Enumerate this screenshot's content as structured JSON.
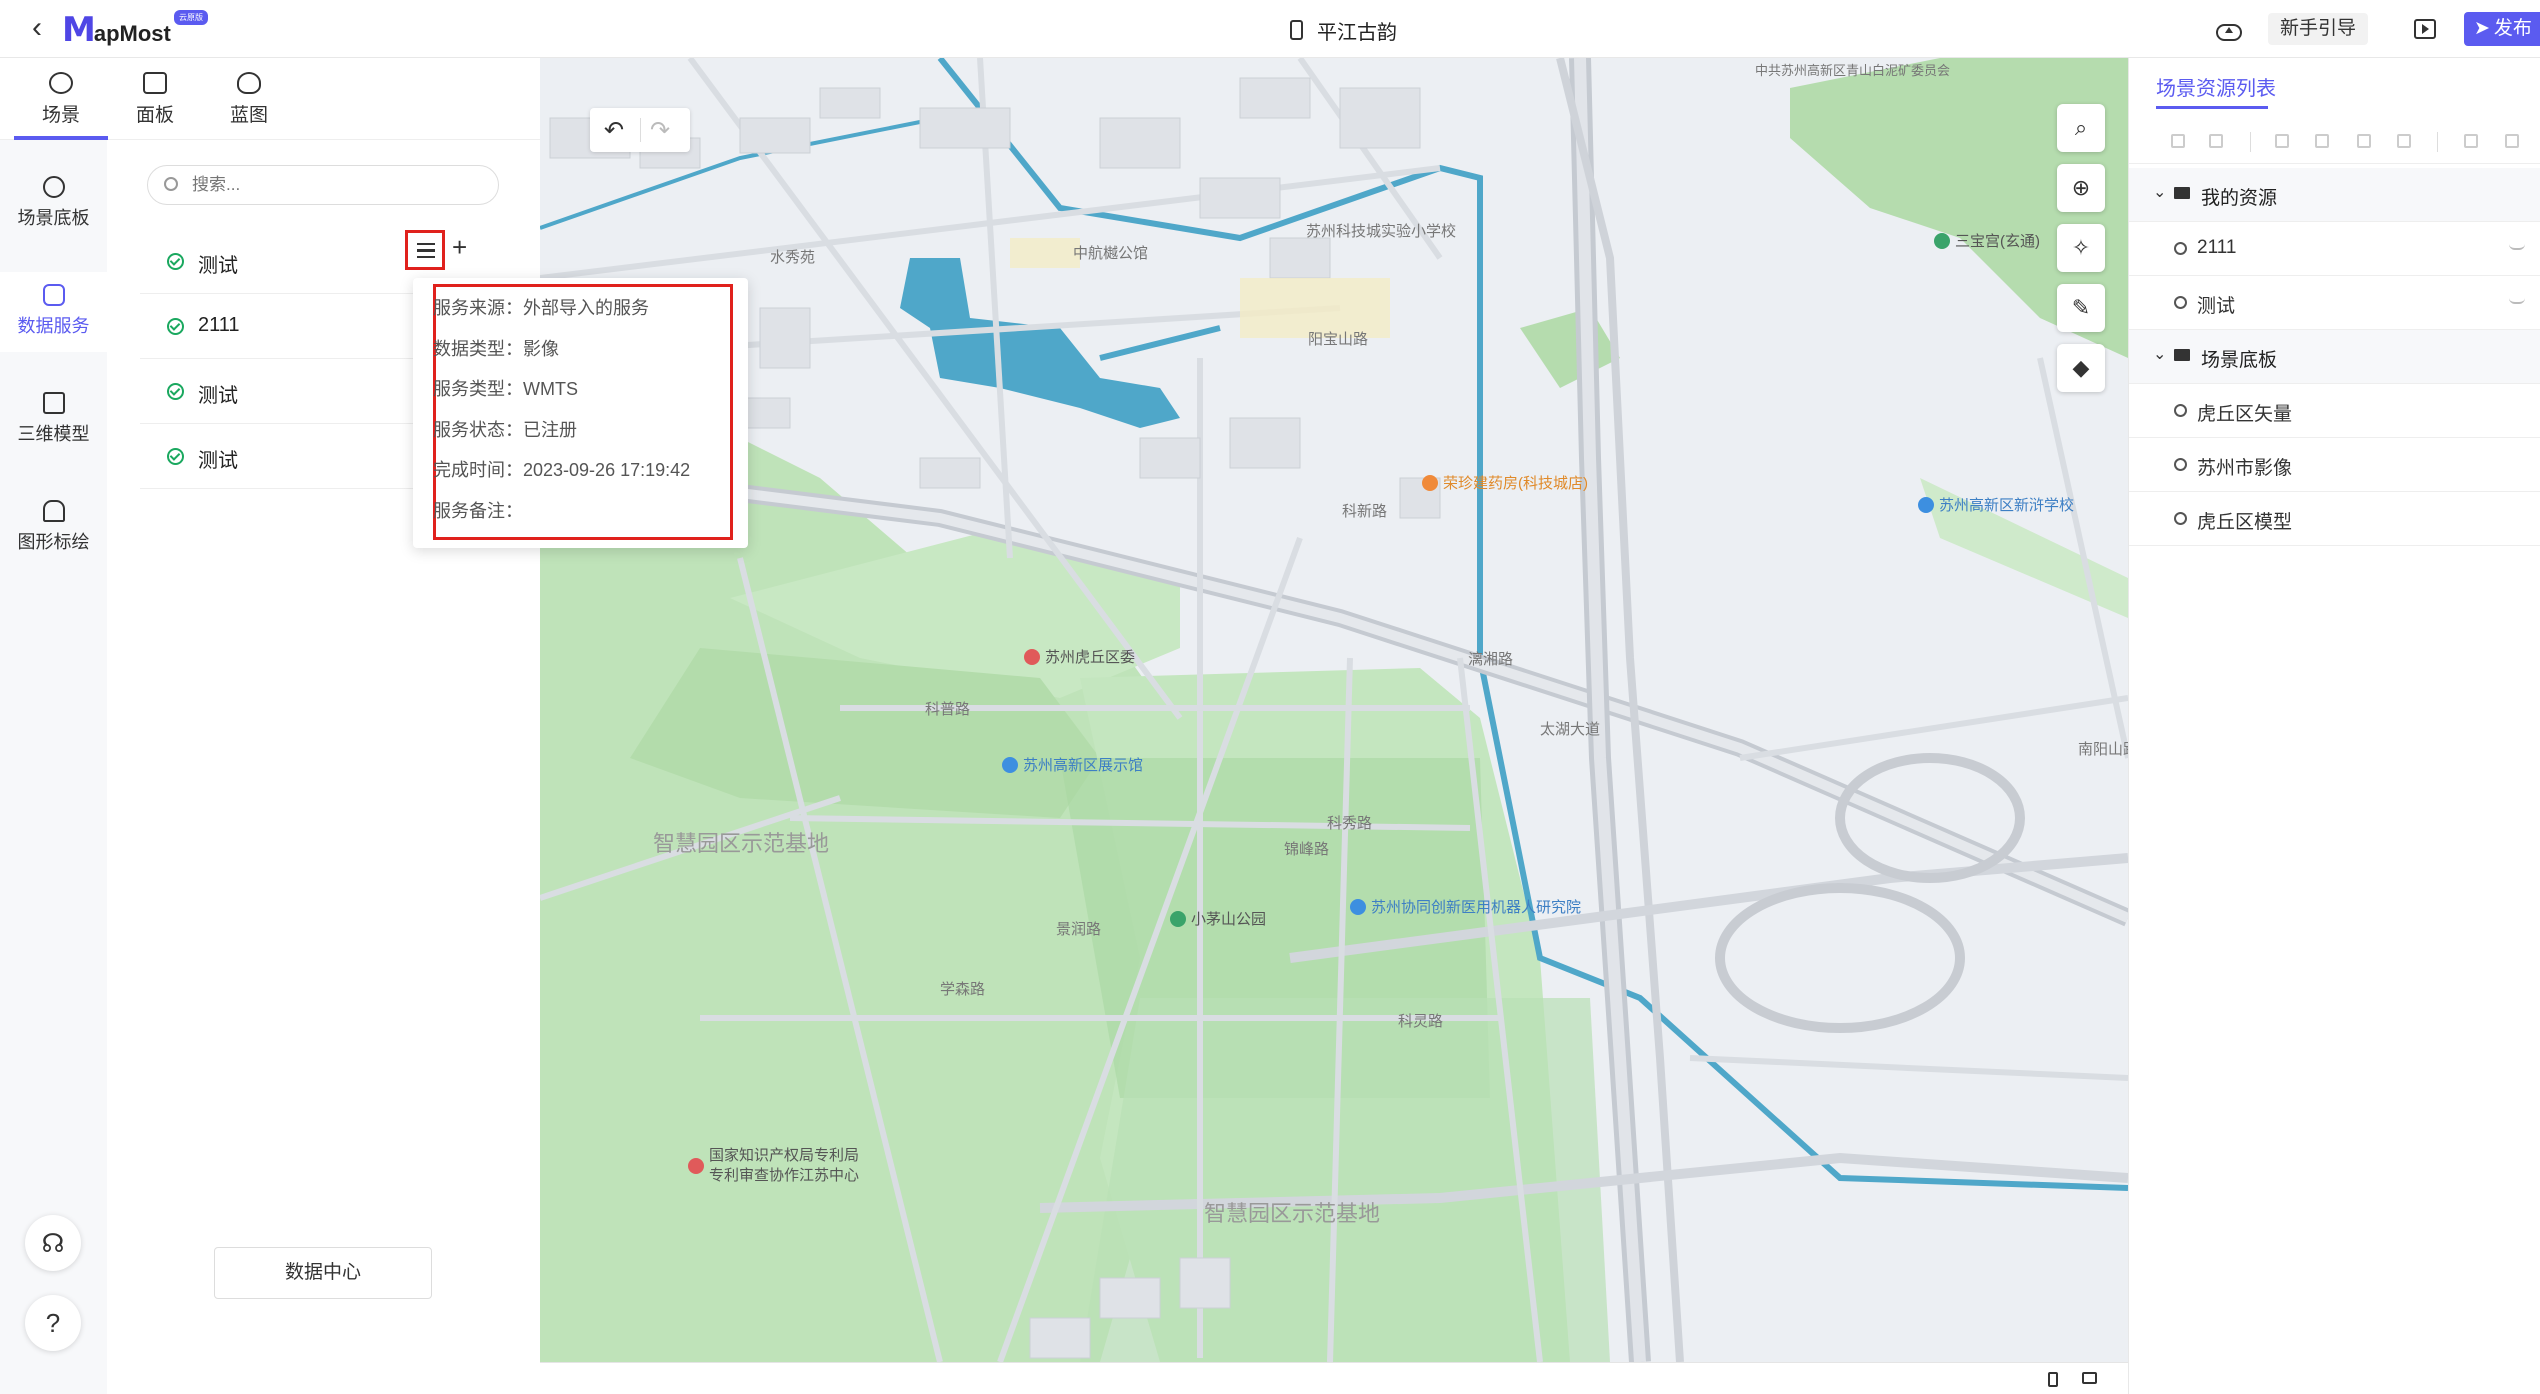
{
  "header": {
    "logo_mark": "M",
    "logo_text": "apMost",
    "logo_badge": "云原版",
    "scene_title": "平江古韵",
    "guide_label": "新手引导",
    "publish_label": "发布"
  },
  "top_tabs": [
    {
      "label": "场景",
      "icon": "scene-icon"
    },
    {
      "label": "面板",
      "icon": "panel-icon"
    },
    {
      "label": "蓝图",
      "icon": "blueprint-icon"
    }
  ],
  "rail": [
    {
      "label": "场景底板",
      "icon": "basemap-icon"
    },
    {
      "label": "数据服务",
      "icon": "database-icon"
    },
    {
      "label": "三维模型",
      "icon": "cube-icon"
    },
    {
      "label": "图形标绘",
      "icon": "plot-icon"
    }
  ],
  "help": {
    "question": "?"
  },
  "search": {
    "placeholder": "搜索..."
  },
  "services": [
    {
      "name": "测试"
    },
    {
      "name": "2111"
    },
    {
      "name": "测试"
    },
    {
      "name": "测试"
    }
  ],
  "data_center_label": "数据中心",
  "popover": {
    "source_key": "服务来源：",
    "source": "外部导入的服务",
    "dtype_key": "数据类型：",
    "dtype": "影像",
    "stype_key": "服务类型：",
    "stype": "WMTS",
    "status_key": "服务状态：",
    "status": "已注册",
    "time_key": "完成时间：",
    "time": "2023-09-26 17:19:42",
    "note_key": "服务备注：",
    "note": ""
  },
  "map": {
    "labels": {
      "l1": "中共苏州高新区青山白泥矿委员会",
      "l2": "水秀苑",
      "l3": "中航樾公馆",
      "l4": "苏州科技城实验小学校",
      "l5": "科普路",
      "l6": "科秀路",
      "l7": "科灵路",
      "l8": "科新路",
      "l9": "太湖大道",
      "l10": "智慧园区示范基地",
      "l11": "智慧园区示范基地",
      "l12": "学森路",
      "l13": "锦峰路",
      "l14": "漓湘路",
      "l15": "景润路",
      "l16": "南阳山路",
      "l17": "阳宝山路"
    },
    "pois": {
      "p1": "苏州虎丘区委",
      "p2": "苏州高新区展示馆",
      "p3": "小茅山公园",
      "p4": "苏州协同创新医用机器人研究院",
      "p5": "国家知识产权局专利局",
      "p5b": "专利审查协作江苏中心",
      "p6": "荣珍建药房(科技城店)",
      "p7": "苏州高新区新浒学校",
      "p8": "三宝宫(玄通)"
    },
    "colors": {
      "green": "#b9e0b5",
      "water": "#4fa7c9",
      "road": "#d5d9df"
    }
  },
  "right_panel": {
    "title": "场景资源列表",
    "groups": [
      {
        "name": "我的资源",
        "items": [
          "2111",
          "测试"
        ]
      },
      {
        "name": "场景底板",
        "items": [
          "虎丘区矢量",
          "苏州市影像",
          "虎丘区模型"
        ]
      }
    ]
  }
}
